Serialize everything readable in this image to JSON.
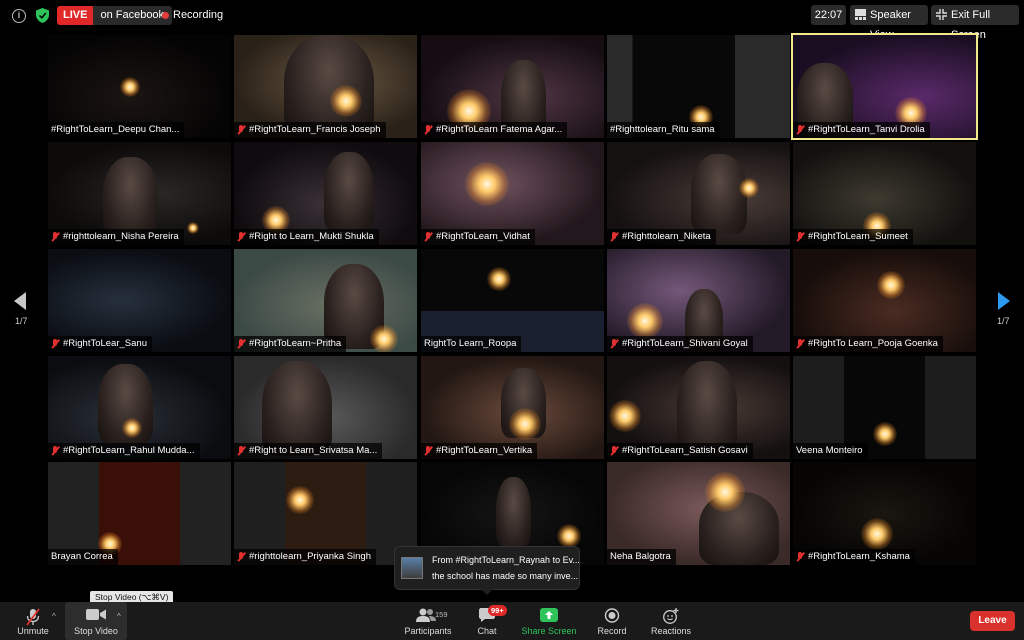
{
  "topbar": {
    "live_label": "LIVE",
    "live_destination": "on Facebook",
    "recording_label": "Recording",
    "time": "22:07",
    "speaker_view_label": "Speaker View",
    "exit_fullscreen_label": "Exit Full Screen"
  },
  "pagination": {
    "left": "1/7",
    "right": "1/7"
  },
  "participants": [
    {
      "name": "#RightToLearn_Deepu Chan...",
      "muted": false
    },
    {
      "name": "#RightToLearn_Francis Joseph",
      "muted": true
    },
    {
      "name": "#RightToLearn Fatema Agar...",
      "muted": true
    },
    {
      "name": "#Righttolearn_Ritu sama",
      "muted": false
    },
    {
      "name": "#RightToLearn_Tanvi Drolia",
      "muted": true,
      "active_speaker": true
    },
    {
      "name": "#righttolearn_Nisha Pereira",
      "muted": true
    },
    {
      "name": "#Right to Learn_Mukti Shukla",
      "muted": true
    },
    {
      "name": "#RightToLearn_Vidhat",
      "muted": true
    },
    {
      "name": "#Righttolearn_Niketa",
      "muted": true
    },
    {
      "name": "#RightToLearn_Sumeet",
      "muted": true
    },
    {
      "name": "#RightToLear_Sanu",
      "muted": true
    },
    {
      "name": "#RightToLearn~Pritha",
      "muted": true
    },
    {
      "name": "RightTo Learn_Roopa",
      "muted": false
    },
    {
      "name": "#RightToLearn_Shivani Goyal",
      "muted": true
    },
    {
      "name": "#RightTo Learn_Pooja Goenka",
      "muted": true
    },
    {
      "name": "#RightToLearn_Rahul Mudda...",
      "muted": true
    },
    {
      "name": "#Right to Learn_Srivatsa Ma...",
      "muted": true
    },
    {
      "name": "#RightToLearn_Vertika",
      "muted": true
    },
    {
      "name": "#RightToLearn_Satish Gosavi",
      "muted": true
    },
    {
      "name": "Veena Monteiro",
      "muted": false
    },
    {
      "name": "Brayan Correa",
      "muted": false
    },
    {
      "name": "#righttolearn_Priyanka Singh",
      "muted": true
    },
    {
      "name": "",
      "muted": false
    },
    {
      "name": "Neha Balgotra",
      "muted": false
    },
    {
      "name": "#RightToLearn_Kshama",
      "muted": true
    }
  ],
  "chat_popup": {
    "line1": "From #RightToLearn_Raynah to Ev...",
    "line2": "the school has made so many inve..."
  },
  "tooltip": "Stop Video (⌥⌘V)",
  "toolbar": {
    "unmute": "Unmute",
    "stop_video": "Stop Video",
    "participants": "Participants",
    "participants_count": "159",
    "chat": "Chat",
    "chat_badge": "99+",
    "share_screen": "Share Screen",
    "record": "Record",
    "reactions": "Reactions",
    "leave": "Leave"
  },
  "colors": {
    "accent_green": "#2ec45a",
    "leave_red": "#d9312b",
    "live_red": "#e02828",
    "active_outline": "#f2e98a",
    "nav_blue": "#2f9bf0"
  }
}
